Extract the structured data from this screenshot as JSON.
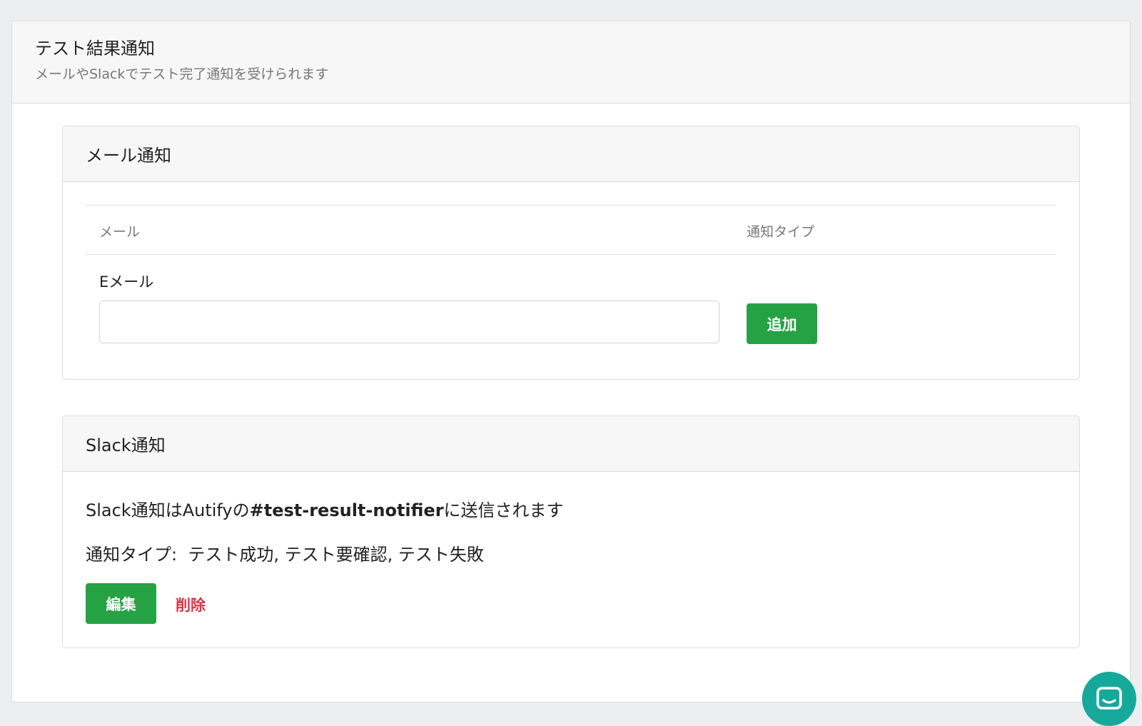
{
  "header": {
    "title": "テスト結果通知",
    "subtitle": "メールやSlackでテスト完了通知を受けられます"
  },
  "mail_section": {
    "title": "メール通知",
    "columns": [
      "メール",
      "通知タイプ"
    ],
    "email_label": "Eメール",
    "email_value": "",
    "add_label": "追加"
  },
  "slack_section": {
    "title": "Slack通知",
    "sent_prefix": "Slack通知はAutifyの",
    "channel": "#test-result-notifier",
    "sent_suffix": "に送信されます",
    "types_label": "通知タイプ:",
    "types_value": "テスト成功, テスト要確認, テスト失敗",
    "edit_label": "編集",
    "delete_label": "削除"
  },
  "colors": {
    "accent_green": "#25a244",
    "danger_red": "#dc3545",
    "chat_teal": "#16a99b"
  },
  "icons": {
    "chat": "chat-bubble-icon"
  }
}
